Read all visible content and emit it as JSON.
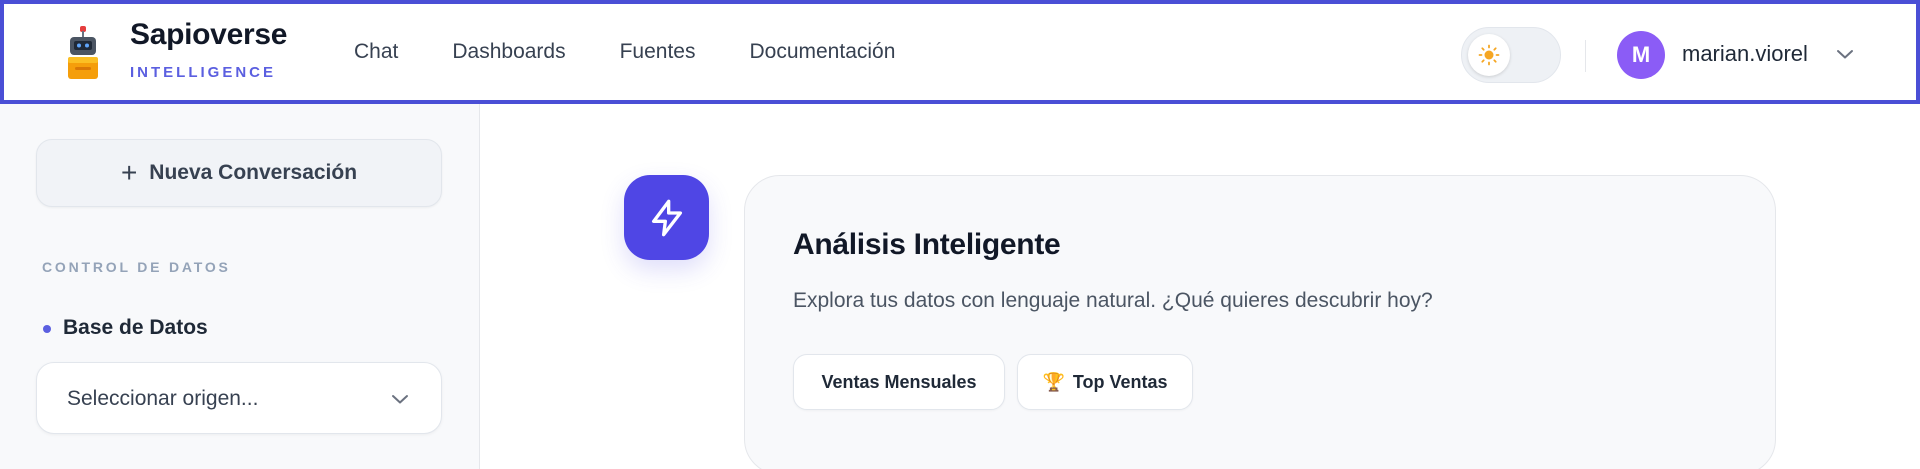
{
  "brand": {
    "name": "Sapioverse",
    "subtitle": "INTELLIGENCE"
  },
  "nav": [
    {
      "label": "Chat"
    },
    {
      "label": "Dashboards"
    },
    {
      "label": "Fuentes"
    },
    {
      "label": "Documentación"
    }
  ],
  "theme_toggle": {
    "mode": "light",
    "icon": "sun-icon"
  },
  "user": {
    "initial": "M",
    "name": "marian.viorel",
    "avatar_color": "#8b5cf6"
  },
  "sidebar": {
    "new_chat_label": "Nueva Conversación",
    "section_title": "CONTROL DE DATOS",
    "db_label": "Base de Datos",
    "select_value": "Seleccionar origen..."
  },
  "main": {
    "title": "Análisis Inteligente",
    "description": "Explora tus datos con lenguaje natural. ¿Qué quieres descubrir hoy?",
    "chips": [
      {
        "label": "Ventas Mensuales"
      },
      {
        "label": "Top Ventas",
        "icon": "trophy-icon"
      }
    ]
  },
  "colors": {
    "accent": "#4f46e5",
    "header_border": "#4a4fd6",
    "brand_subtitle": "#5b5fe0",
    "sun": "#f5a623"
  }
}
